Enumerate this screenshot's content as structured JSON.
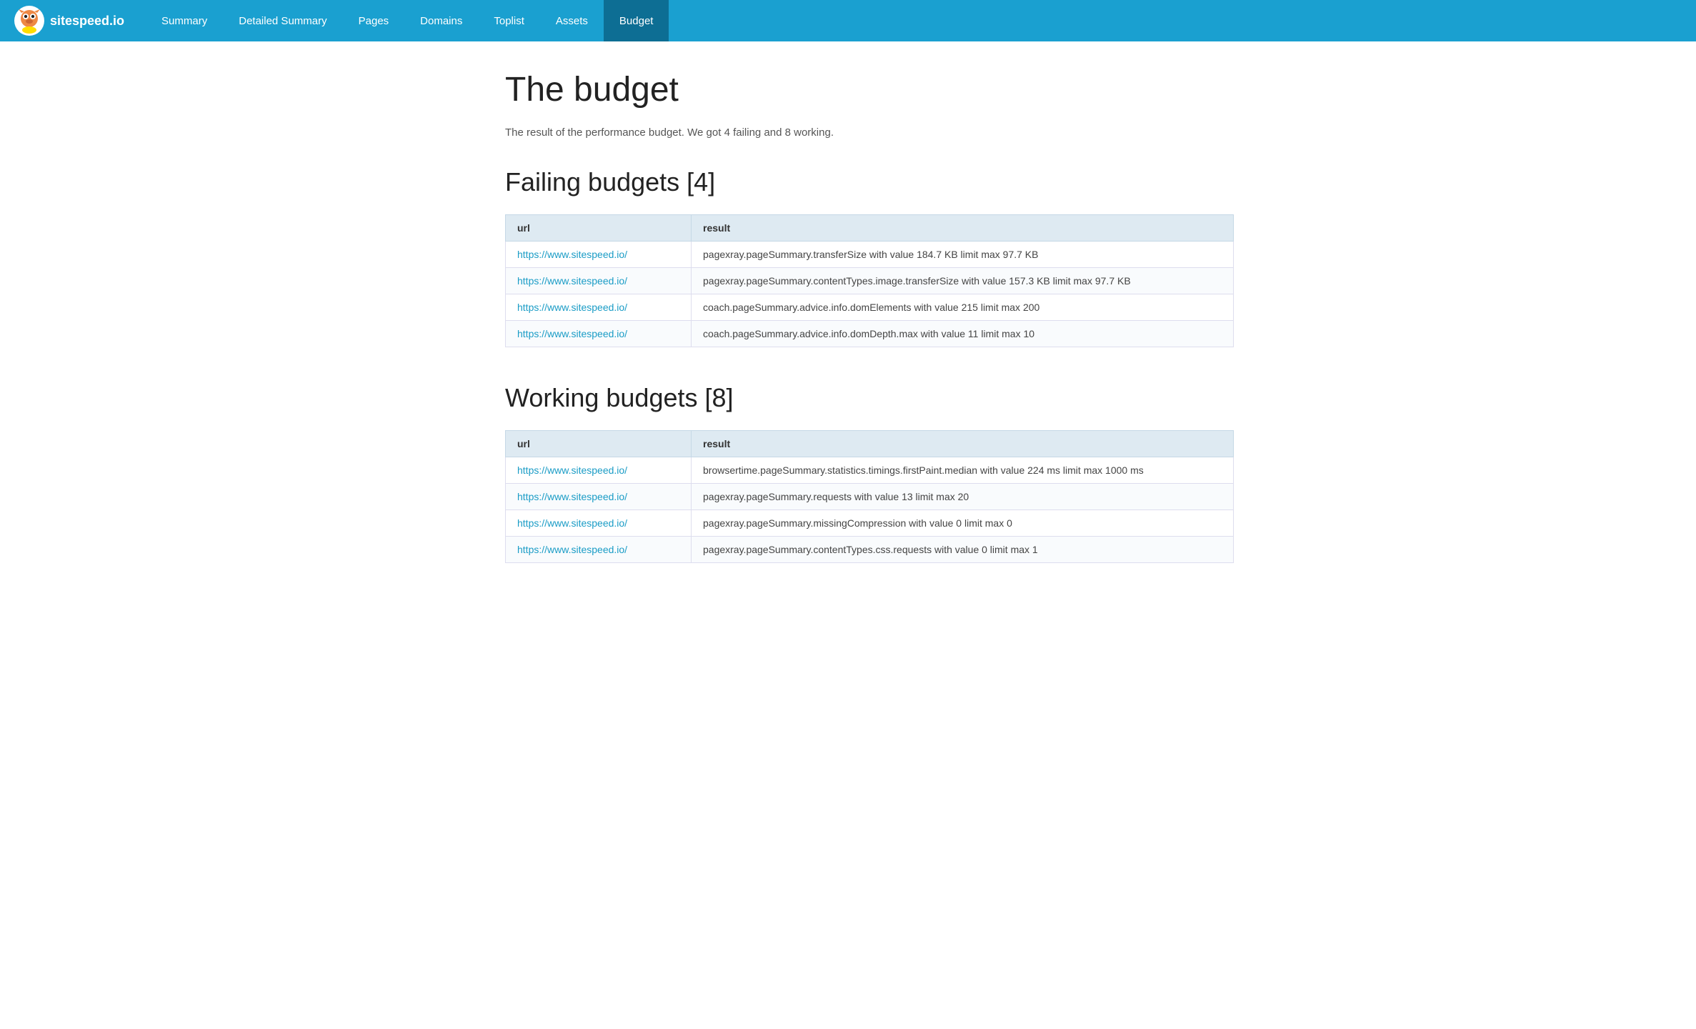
{
  "nav": {
    "logo_text": "sitespeed.io",
    "links": [
      {
        "label": "Summary",
        "active": false
      },
      {
        "label": "Detailed Summary",
        "active": false
      },
      {
        "label": "Pages",
        "active": false
      },
      {
        "label": "Domains",
        "active": false
      },
      {
        "label": "Toplist",
        "active": false
      },
      {
        "label": "Assets",
        "active": false
      },
      {
        "label": "Budget",
        "active": true
      }
    ]
  },
  "page": {
    "title": "The budget",
    "subtitle": "The result of the performance budget. We got 4 failing and 8 working.",
    "failing_heading": "Failing budgets [4]",
    "working_heading": "Working budgets [8]",
    "table_col_url": "url",
    "table_col_result": "result",
    "failing_rows": [
      {
        "url": "https://www.sitespeed.io/",
        "result": "pagexray.pageSummary.transferSize with value 184.7 KB limit max 97.7 KB"
      },
      {
        "url": "https://www.sitespeed.io/",
        "result": "pagexray.pageSummary.contentTypes.image.transferSize with value 157.3 KB limit max 97.7 KB"
      },
      {
        "url": "https://www.sitespeed.io/",
        "result": "coach.pageSummary.advice.info.domElements with value 215 limit max 200"
      },
      {
        "url": "https://www.sitespeed.io/",
        "result": "coach.pageSummary.advice.info.domDepth.max with value 11 limit max 10"
      }
    ],
    "working_rows": [
      {
        "url": "https://www.sitespeed.io/",
        "result": "browsertime.pageSummary.statistics.timings.firstPaint.median with value 224 ms limit max 1000 ms"
      },
      {
        "url": "https://www.sitespeed.io/",
        "result": "pagexray.pageSummary.requests with value 13 limit max 20"
      },
      {
        "url": "https://www.sitespeed.io/",
        "result": "pagexray.pageSummary.missingCompression with value 0 limit max 0"
      },
      {
        "url": "https://www.sitespeed.io/",
        "result": "pagexray.pageSummary.contentTypes.css.requests with value 0 limit max 1"
      }
    ]
  }
}
